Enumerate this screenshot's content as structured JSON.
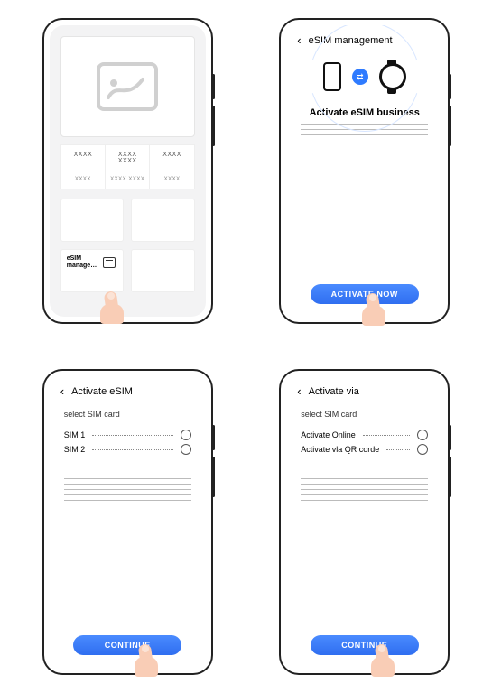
{
  "screen1": {
    "tiles_row1": [
      "XXXX",
      "XXXX  XXXX",
      "XXXX"
    ],
    "tiles_row2": [
      "XXXX",
      "XXXX  XXXX",
      "XXXX"
    ],
    "esim_tile_label": "eSIM manage…"
  },
  "screen2": {
    "header": "eSIM management",
    "title": "Activate eSIM business",
    "button": "ACTIVATE NOW"
  },
  "screen3": {
    "header": "Activate eSIM",
    "subtitle": "select SIM card",
    "options": [
      "SIM 1",
      "SIM 2"
    ],
    "button": "CONTINUE"
  },
  "screen4": {
    "header": "Activate via",
    "subtitle": "select SIM card",
    "options": [
      "Activate Online",
      "Activate vla QR corde"
    ],
    "button": "CONTINUE"
  }
}
